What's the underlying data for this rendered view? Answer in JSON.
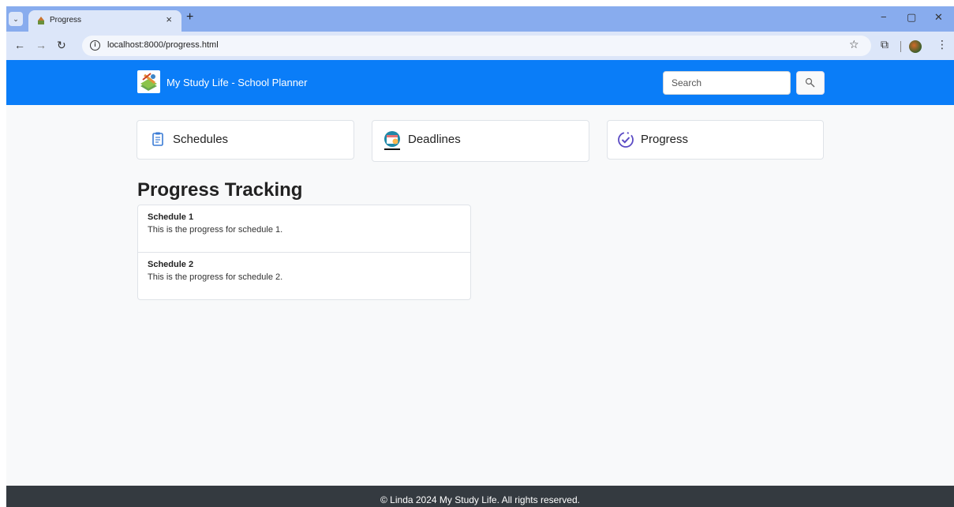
{
  "browser": {
    "tab_title": "Progress",
    "url": "localhost:8000/progress.html"
  },
  "navbar": {
    "brand": "My Study Life - School Planner",
    "search_placeholder": "Search"
  },
  "cards": [
    {
      "label": "Schedules",
      "icon": "clipboard-icon"
    },
    {
      "label": "Deadlines",
      "icon": "calendar-clock-icon"
    },
    {
      "label": "Progress",
      "icon": "check-circle-icon"
    }
  ],
  "main": {
    "title": "Progress Tracking",
    "items": [
      {
        "title": "Schedule 1",
        "desc": "This is the progress for schedule 1."
      },
      {
        "title": "Schedule 2",
        "desc": "This is the progress for schedule 2."
      }
    ]
  },
  "footer": {
    "text": "© Linda 2024 My Study Life. All rights reserved."
  },
  "colors": {
    "navbar": "#0a7df8",
    "footer": "#343a40",
    "page_bg": "#f8f9fa"
  }
}
